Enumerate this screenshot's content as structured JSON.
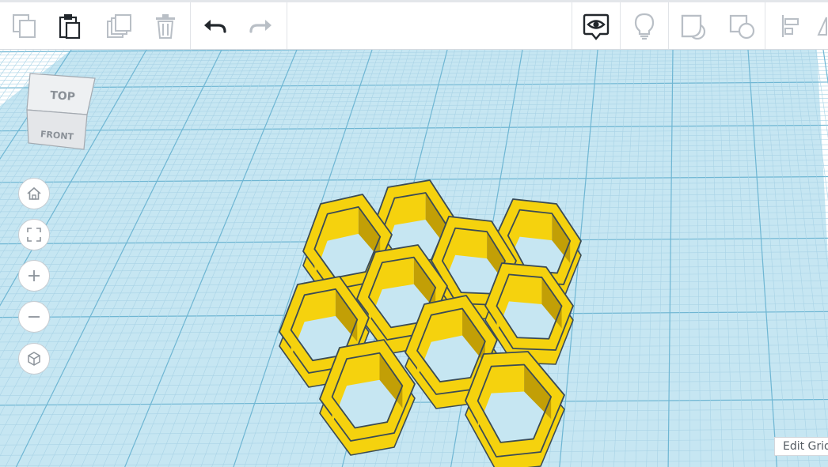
{
  "toolbar": {
    "left_tools": [
      {
        "name": "copy",
        "icon": "copy-icon",
        "enabled": false
      },
      {
        "name": "paste",
        "icon": "paste-icon",
        "enabled": true
      },
      {
        "name": "duplicate",
        "icon": "duplicate-icon",
        "enabled": false
      },
      {
        "name": "delete",
        "icon": "trash-icon",
        "enabled": false
      },
      {
        "name": "undo",
        "icon": "undo-icon",
        "enabled": true
      },
      {
        "name": "redo",
        "icon": "redo-icon",
        "enabled": false
      }
    ],
    "right_tools": [
      {
        "name": "show-all",
        "icon": "eye-bubble-icon",
        "enabled": true
      },
      {
        "name": "notes",
        "icon": "lightbulb-icon",
        "enabled": false
      },
      {
        "name": "group",
        "icon": "group-icon",
        "enabled": false
      },
      {
        "name": "ungroup",
        "icon": "ungroup-icon",
        "enabled": false
      },
      {
        "name": "align",
        "icon": "align-icon",
        "enabled": false
      },
      {
        "name": "mirror",
        "icon": "mirror-icon",
        "enabled": false
      }
    ]
  },
  "view_cube": {
    "top_label": "TOP",
    "front_label": "FRONT"
  },
  "nav_controls": [
    "home-icon",
    "fit-icon",
    "zoom-in-icon",
    "zoom-out-icon",
    "perspective-icon"
  ],
  "edit_grid_label": "Edit Grid",
  "colors": {
    "grid_background": "#c6e6f2",
    "grid_minor": "#a9d3e6",
    "grid_major": "#6fb6d3",
    "shape_yellow": "#f5d20e",
    "shape_shadow": "#c29f06",
    "shape_outline": "#3b4b55",
    "icon_active": "#22272c",
    "icon_disabled": "#b9bfc6"
  },
  "workplane_object": {
    "shape": "honeycomb",
    "cell_count": 10
  }
}
